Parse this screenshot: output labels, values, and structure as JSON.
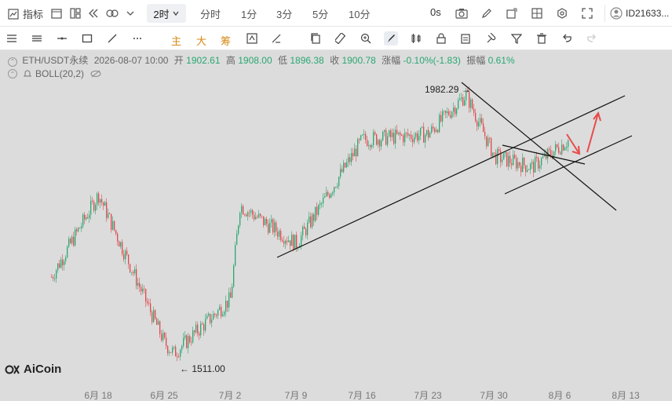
{
  "topbar": {
    "indicators_label": "指标",
    "active_period": "2时",
    "periods": [
      "分时",
      "1分",
      "3分",
      "5分",
      "10分"
    ],
    "countdown": "0s",
    "account_id": "ID21633..."
  },
  "drawbar": {
    "main_label": "主",
    "big_label": "大",
    "filter_label": "筹"
  },
  "chart": {
    "symbol": "ETH/USDT永续",
    "datetime": "2026-08-07 10:00",
    "open_label": "开",
    "open": "1902.61",
    "high_label": "高",
    "high": "1908.00",
    "low_label": "低",
    "low": "1896.38",
    "close_label": "收",
    "close": "1900.78",
    "change_label": "涨幅",
    "change": "-0.10%(-1.83)",
    "amplitude_label": "振幅",
    "amplitude": "0.61%",
    "indicator": "BOLL(20,2)",
    "high_annotation": "1982.29",
    "low_annotation": "1511.00",
    "logo_text": "AiCoin",
    "x_ticks": [
      "6月 18",
      "6月 25",
      "7月 2",
      "7月 9",
      "7月 16",
      "7月 23",
      "7月 30",
      "8月 6",
      "8月 13"
    ],
    "colors": {
      "up": "#2aa772",
      "down": "#e0484b",
      "background": "#dcdcdc",
      "arrow": "#e84c4c"
    }
  },
  "chart_data": {
    "type": "candlestick",
    "title": "",
    "x_range": [
      "6月 13",
      "8月 14"
    ],
    "y_range": [
      1490,
      2000
    ],
    "key_points": [
      {
        "x": "6月 13",
        "y": 1650
      },
      {
        "x": "6月 18",
        "y": 1800
      },
      {
        "x": "6月 25",
        "y": 1530
      },
      {
        "x": "6月 26",
        "y": 1511.0
      },
      {
        "x": "7月 2",
        "y": 1610
      },
      {
        "x": "7月 3",
        "y": 1780
      },
      {
        "x": "7月 9",
        "y": 1710
      },
      {
        "x": "7月 16",
        "y": 1900
      },
      {
        "x": "7月 23",
        "y": 1910
      },
      {
        "x": "7月 27",
        "y": 1982.29
      },
      {
        "x": "7月 30",
        "y": 1870
      },
      {
        "x": "8月 3",
        "y": 1850
      },
      {
        "x": "8月 7",
        "y": 1900.78
      }
    ],
    "trendlines": 4,
    "arrows": 2
  }
}
